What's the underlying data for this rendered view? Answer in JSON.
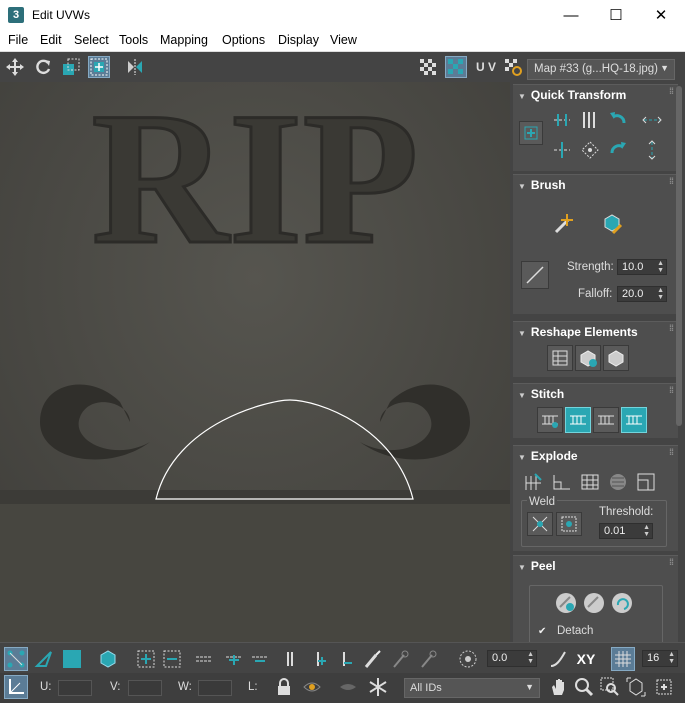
{
  "window": {
    "title": "Edit UVWs",
    "app_icon": "3",
    "minimize": "—",
    "maximize": "☐",
    "close": "✕"
  },
  "menu": [
    "File",
    "Edit",
    "Select",
    "Tools",
    "Mapping",
    "Options",
    "Display",
    "View"
  ],
  "toolbar": {
    "uv_label": "U V",
    "map_select": "Map #33 (g...HQ-18.jpg)"
  },
  "rollouts": {
    "quick_transform": {
      "title": "Quick Transform"
    },
    "brush": {
      "title": "Brush",
      "strength_label": "Strength:",
      "strength_value": "10.0",
      "falloff_label": "Falloff:",
      "falloff_value": "20.0"
    },
    "reshape": {
      "title": "Reshape Elements"
    },
    "stitch": {
      "title": "Stitch"
    },
    "explode": {
      "title": "Explode",
      "weld_label": "Weld",
      "threshold_label": "Threshold:",
      "threshold_value": "0.01"
    },
    "peel": {
      "title": "Peel",
      "detach_label": "Detach",
      "detach_checked": true
    }
  },
  "viewport": {
    "texture_text": "RIP"
  },
  "bottom_toolbar": {
    "rotate_value": "0.0",
    "xy_label": "XY",
    "grid_value": "16"
  },
  "status_bar": {
    "u_label": "U:",
    "v_label": "V:",
    "w_label": "W:",
    "l_label": "L:",
    "ids_select": "All IDs"
  },
  "colors": {
    "accent": "#2aa7b3",
    "panel": "#444444",
    "selection_on": "#5b7c96"
  }
}
